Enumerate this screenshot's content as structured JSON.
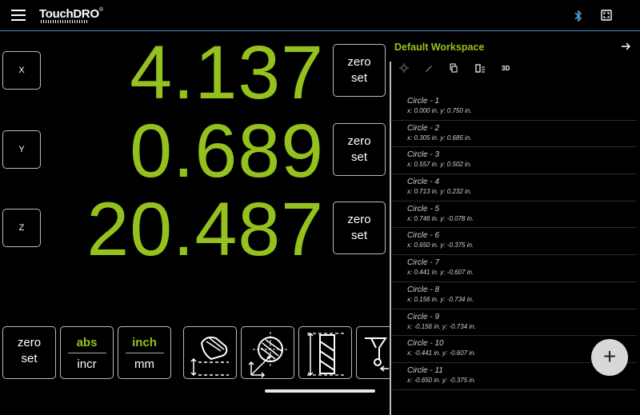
{
  "app": {
    "logo_text": "TouchDRO",
    "logo_mark": "®"
  },
  "colors": {
    "accent": "#95c11f",
    "background": "#000000",
    "topbar_line": "#3a8fd0",
    "bluetooth": "#4fa3e0"
  },
  "icons": {
    "menu": "hamburger-menu-icon",
    "bluetooth": "bluetooth-icon",
    "fullscreen": "fullscreen-icon",
    "panel_close": "arrow-right-icon",
    "add": "plus-icon"
  },
  "axes": [
    {
      "label": "X",
      "value": "4.137",
      "zero_line1": "zero",
      "zero_line2": "set"
    },
    {
      "label": "Y",
      "value": "0.689",
      "zero_line1": "zero",
      "zero_line2": "set"
    },
    {
      "label": "Z",
      "value": "20.487",
      "zero_line1": "zero",
      "zero_line2": "set"
    }
  ],
  "bottom": {
    "zero_set": {
      "line1": "zero",
      "line2": "set"
    },
    "abs_incr": {
      "top": "abs",
      "bottom": "incr"
    },
    "inch_mm": {
      "top": "inch",
      "bottom": "mm"
    },
    "tools": [
      "edge-finder-icon",
      "bolt-circle-icon",
      "tool-length-icon",
      "probe-icon"
    ]
  },
  "workspace": {
    "title": "Default Workspace",
    "toolbar": [
      "target-icon",
      "edit-pencil-icon",
      "copy-icon",
      "delete-list-icon"
    ],
    "toolbar_3d": "3D",
    "items": [
      {
        "name": "Circle - 1",
        "coords": "x: 0.000 in. y: 0.750 in."
      },
      {
        "name": "Circle - 2",
        "coords": "x: 0.305 in. y: 0.685 in."
      },
      {
        "name": "Circle - 3",
        "coords": "x: 0.557 in. y: 0.502 in."
      },
      {
        "name": "Circle - 4",
        "coords": "x: 0.713 in. y: 0.232 in."
      },
      {
        "name": "Circle - 5",
        "coords": "x: 0.746 in. y: -0.078 in."
      },
      {
        "name": "Circle - 6",
        "coords": "x: 0.650 in. y: -0.375 in."
      },
      {
        "name": "Circle - 7",
        "coords": "x: 0.441 in. y: -0.607 in."
      },
      {
        "name": "Circle - 8",
        "coords": "x: 0.156 in. y: -0.734 in."
      },
      {
        "name": "Circle - 9",
        "coords": "x: -0.156 in. y: -0.734 in."
      },
      {
        "name": "Circle - 10",
        "coords": "x: -0.441 in. y: -0.607 in."
      },
      {
        "name": "Circle - 11",
        "coords": "x: -0.650 in. y: -0.375 in."
      }
    ]
  },
  "fab_label": "+"
}
